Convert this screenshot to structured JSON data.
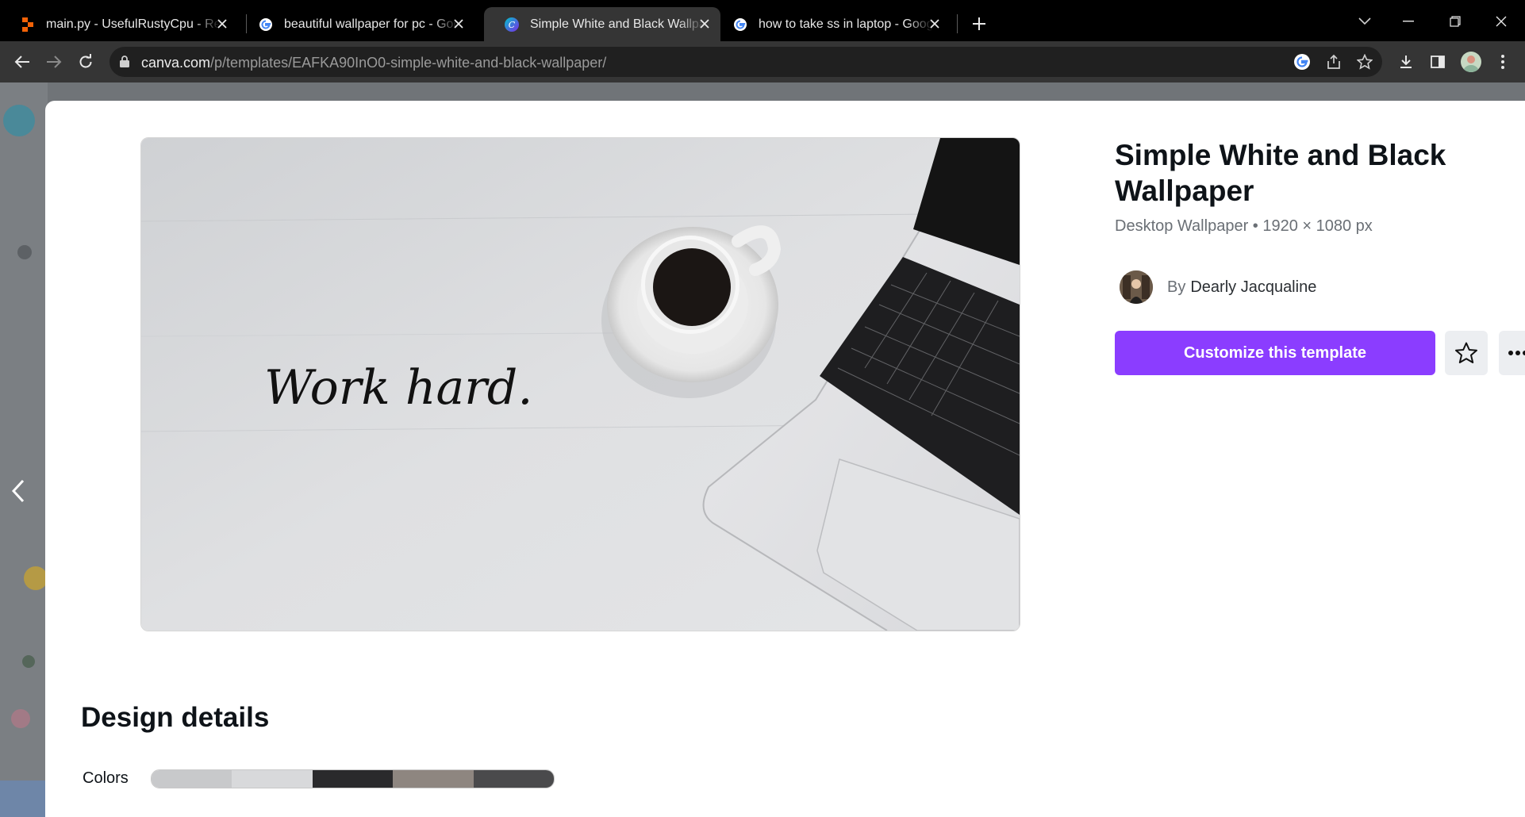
{
  "tabs": [
    {
      "title": "main.py - UsefulRustyCpu - Replit",
      "favicon": "replit-icon",
      "active": false
    },
    {
      "title": "beautiful wallpaper for pc - Google Search",
      "favicon": "google-icon",
      "active": false
    },
    {
      "title": "Simple White and Black Wallpaper",
      "favicon": "canva-icon",
      "active": true
    },
    {
      "title": "how to take ss in laptop - Google Search",
      "favicon": "google-icon",
      "active": false
    }
  ],
  "address_bar": {
    "host": "canva.com",
    "path": "/p/templates/EAFKA90InO0-simple-white-and-black-wallpaper/"
  },
  "template": {
    "title": "Simple White and Black Wallpaper",
    "subtitle": "Desktop Wallpaper • 1920 × 1080 px",
    "author_prefix": "By",
    "author_name": "Dearly Jacqualine",
    "customize_label": "Customize this template",
    "preview_text": "Work hard."
  },
  "design_details": {
    "heading": "Design details",
    "colors_label": "Colors",
    "colors": [
      "#c8c9cb",
      "#d8d9db",
      "#2a2a2c",
      "#8e8680",
      "#4a4a4c"
    ]
  },
  "theme": {
    "accent": "#8b3dff"
  }
}
